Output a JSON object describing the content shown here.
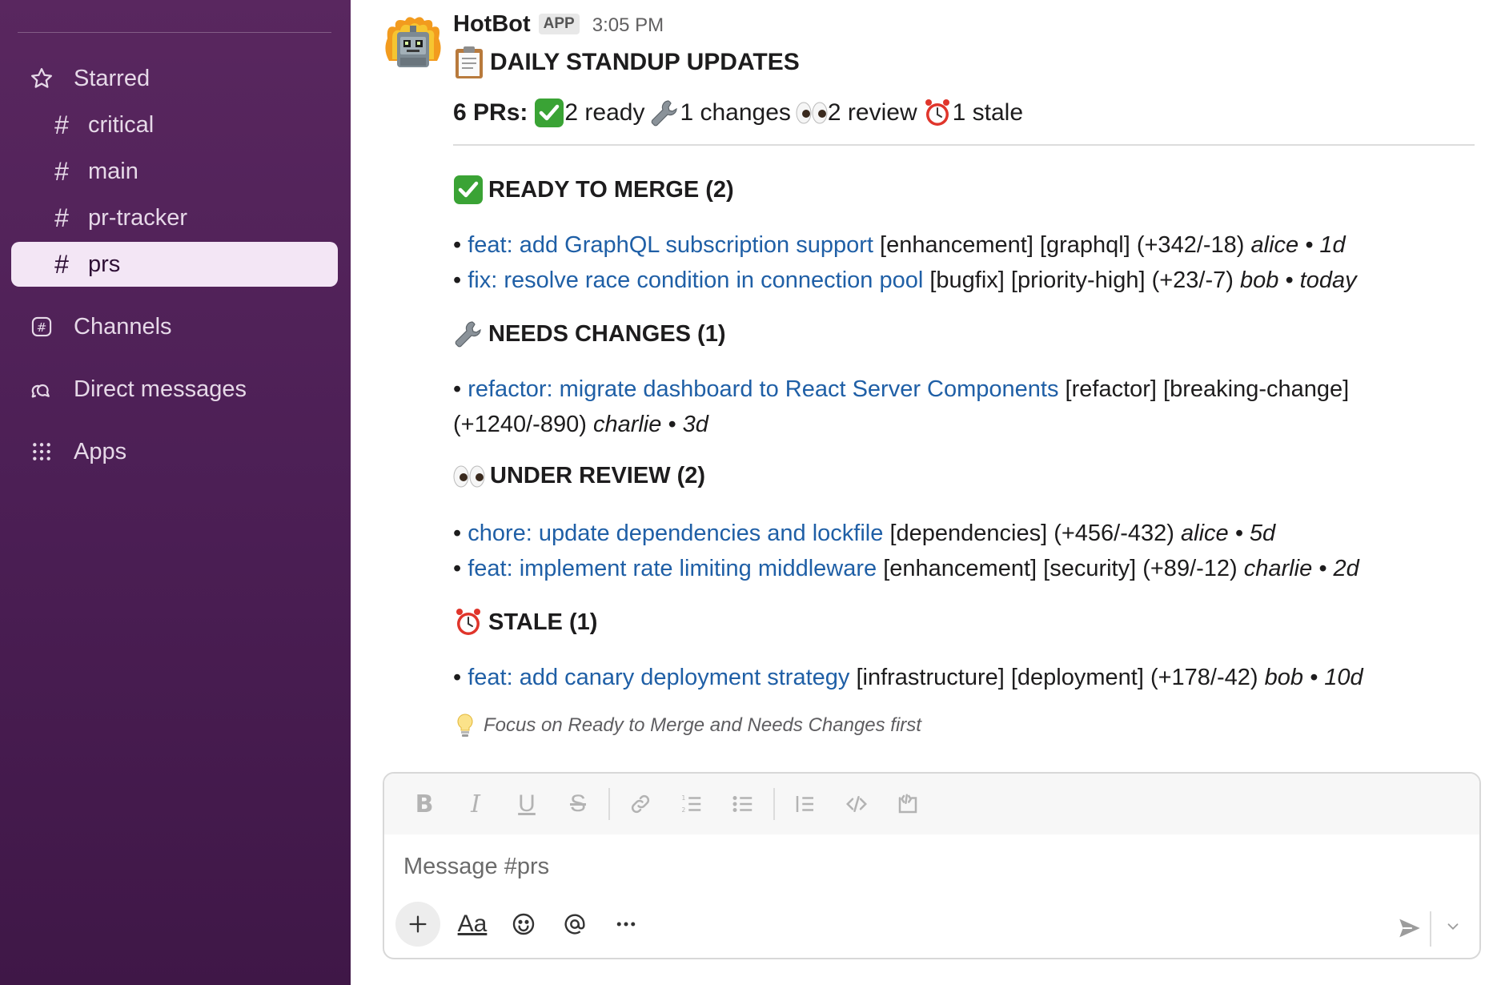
{
  "sidebar": {
    "sections": [
      {
        "label": "Starred",
        "icon": "star-icon"
      },
      {
        "label": "Channels",
        "icon": "channels-icon"
      },
      {
        "label": "Direct messages",
        "icon": "direct-messages-icon"
      },
      {
        "label": "Apps",
        "icon": "apps-icon"
      }
    ],
    "channels": [
      {
        "label": "critical"
      },
      {
        "label": "main"
      },
      {
        "label": "pr-tracker"
      },
      {
        "label": "prs",
        "active": true
      }
    ]
  },
  "message": {
    "author": "HotBot",
    "badge": "APP",
    "time": "3:05 PM",
    "title": "DAILY STANDUP UPDATES",
    "summary": {
      "prefix": "6 PRs:",
      "ready": "2 ready",
      "changes": "1 changes",
      "review": "2 review",
      "stale": "1 stale"
    },
    "sections": {
      "ready": {
        "heading": "READY TO MERGE (2)",
        "items": [
          {
            "link": "feat: add GraphQL subscription support",
            "tags": "[enhancement] [graphql] (+342/-18)",
            "meta": "alice • 1d"
          },
          {
            "link": "fix: resolve race condition in connection pool",
            "tags": "[bugfix] [priority-high] (+23/-7)",
            "meta": "bob • today"
          }
        ]
      },
      "changes": {
        "heading": "NEEDS CHANGES (1)",
        "items": [
          {
            "link": "refactor: migrate dashboard to React Server Components",
            "tags": "[refactor] [breaking-change]",
            "tags2": "(+1240/-890)",
            "meta": "charlie • 3d"
          }
        ]
      },
      "review": {
        "heading": "UNDER REVIEW (2)",
        "items": [
          {
            "link": "chore: update dependencies and lockfile",
            "tags": "[dependencies] (+456/-432)",
            "meta": "alice • 5d"
          },
          {
            "link": "feat: implement rate limiting middleware",
            "tags": "[enhancement] [security] (+89/-12)",
            "meta": "charlie • 2d"
          }
        ]
      },
      "stale": {
        "heading": "STALE (1)",
        "items": [
          {
            "link": "feat: add canary deployment strategy",
            "tags": "[infrastructure] [deployment] (+178/-42)",
            "meta": "bob • 10d"
          }
        ]
      }
    },
    "tip": "Focus on Ready to Merge and Needs Changes first"
  },
  "composer": {
    "placeholder": "Message #prs",
    "text_format_label": "Aa"
  },
  "colors": {
    "sidebar_bg": "#4c1f55",
    "active_channel_bg": "#f3e6f5",
    "link": "#1f5fa6",
    "check_green": "#3aa335",
    "alarm_red": "#e0352b"
  }
}
